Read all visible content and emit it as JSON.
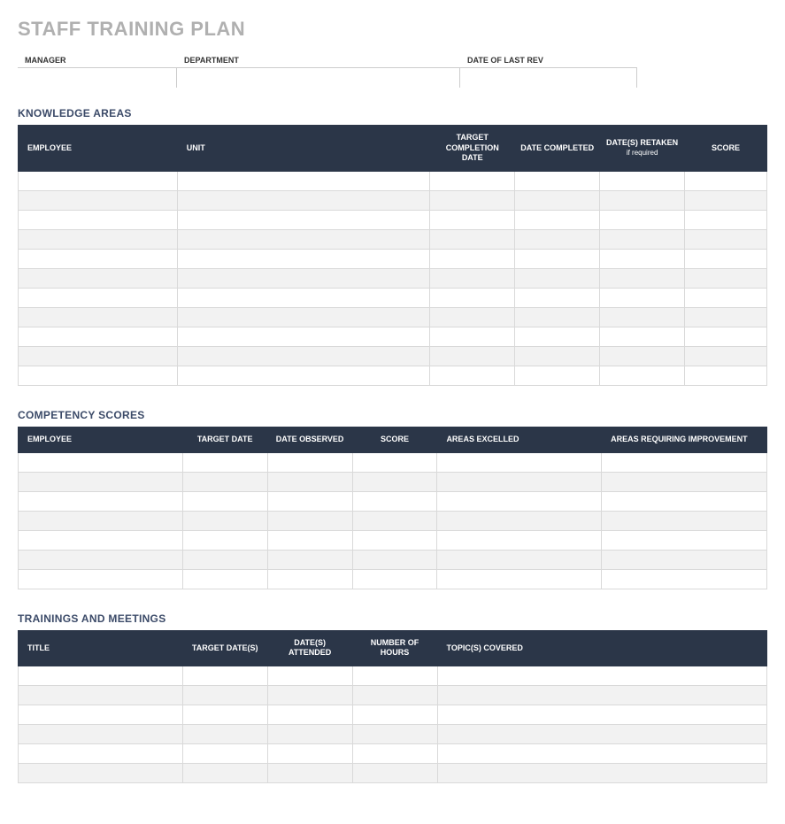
{
  "title": "STAFF TRAINING PLAN",
  "meta": {
    "manager_label": "MANAGER",
    "manager_value": "",
    "department_label": "DEPARTMENT",
    "department_value": "",
    "rev_label": "DATE OF LAST REV",
    "rev_value": ""
  },
  "sections": {
    "knowledge": {
      "heading": "KNOWLEDGE AREAS",
      "headers": {
        "employee": "EMPLOYEE",
        "unit": "UNIT",
        "target": "TARGET COMPLETION DATE",
        "completed": "DATE COMPLETED",
        "retaken": "DATE(S) RETAKEN",
        "retaken_sub": "if required",
        "score": "SCORE"
      },
      "rows": [
        [
          "",
          "",
          "",
          "",
          "",
          ""
        ],
        [
          "",
          "",
          "",
          "",
          "",
          ""
        ],
        [
          "",
          "",
          "",
          "",
          "",
          ""
        ],
        [
          "",
          "",
          "",
          "",
          "",
          ""
        ],
        [
          "",
          "",
          "",
          "",
          "",
          ""
        ],
        [
          "",
          "",
          "",
          "",
          "",
          ""
        ],
        [
          "",
          "",
          "",
          "",
          "",
          ""
        ],
        [
          "",
          "",
          "",
          "",
          "",
          ""
        ],
        [
          "",
          "",
          "",
          "",
          "",
          ""
        ],
        [
          "",
          "",
          "",
          "",
          "",
          ""
        ],
        [
          "",
          "",
          "",
          "",
          "",
          ""
        ]
      ]
    },
    "competency": {
      "heading": "COMPETENCY SCORES",
      "headers": {
        "employee": "EMPLOYEE",
        "target": "TARGET DATE",
        "observed": "DATE OBSERVED",
        "score": "SCORE",
        "excelled": "AREAS EXCELLED",
        "improve": "AREAS REQUIRING IMPROVEMENT"
      },
      "rows": [
        [
          "",
          "",
          "",
          "",
          "",
          ""
        ],
        [
          "",
          "",
          "",
          "",
          "",
          ""
        ],
        [
          "",
          "",
          "",
          "",
          "",
          ""
        ],
        [
          "",
          "",
          "",
          "",
          "",
          ""
        ],
        [
          "",
          "",
          "",
          "",
          "",
          ""
        ],
        [
          "",
          "",
          "",
          "",
          "",
          ""
        ],
        [
          "",
          "",
          "",
          "",
          "",
          ""
        ]
      ]
    },
    "trainings": {
      "heading": "TRAININGS AND MEETINGS",
      "headers": {
        "title": "TITLE",
        "target": "TARGET DATE(S)",
        "attended": "DATE(S) ATTENDED",
        "hours": "NUMBER OF HOURS",
        "topics": "TOPIC(S) COVERED"
      },
      "rows": [
        [
          "",
          "",
          "",
          "",
          ""
        ],
        [
          "",
          "",
          "",
          "",
          ""
        ],
        [
          "",
          "",
          "",
          "",
          ""
        ],
        [
          "",
          "",
          "",
          "",
          ""
        ],
        [
          "",
          "",
          "",
          "",
          ""
        ],
        [
          "",
          "",
          "",
          "",
          ""
        ]
      ]
    }
  }
}
